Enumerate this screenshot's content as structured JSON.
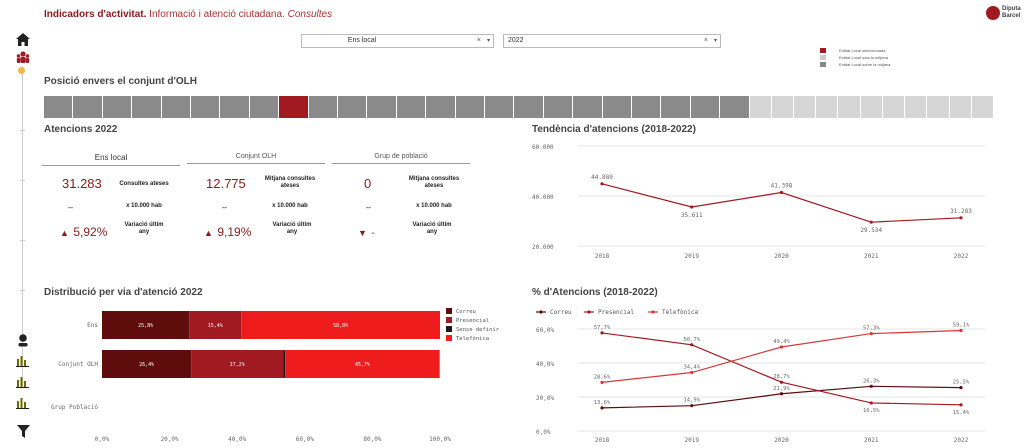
{
  "header": {
    "title_bold": "Indicadors d'activitat.",
    "title_normal": " Informació i atenció ciutadana.",
    "title_italic": " Consultes",
    "logo_line1": "Diputa",
    "logo_line2": "Barcel"
  },
  "filters": {
    "ens": "Ens local",
    "year": "2022",
    "clear": "×",
    "chevron": "▾"
  },
  "legend": {
    "items": [
      {
        "label": "Entitat Local seleccionada",
        "color": "#a11a22"
      },
      {
        "label": "Entitat Local sota la mitjana",
        "color": "#cccccc"
      },
      {
        "label": "Entitat Local sobre la mitjana",
        "color": "#888888"
      }
    ]
  },
  "position": {
    "title": "Posició envers el conjunt d'OLH",
    "dark_count": 24,
    "light_count": 11,
    "selected_index": 8,
    "colors": {
      "dark": "#8a8a8a",
      "light": "#d6d6d6",
      "selected": "#a11a22"
    }
  },
  "atencions": {
    "title": "Atencions 2022",
    "cols": [
      {
        "header": "Ens local",
        "value": "31.283",
        "value_label": "Consultes ateses",
        "dash": "–",
        "per_label": "x 10.000 hab",
        "var_arrow": "▲",
        "var_value": "5,92%",
        "var_label": "Variació últim any"
      },
      {
        "header": "Conjunt OLH",
        "value": "12.775",
        "value_label": "Mitjana consultes ateses",
        "dash": "–",
        "per_label": "x 10.000 hab",
        "var_arrow": "▲",
        "var_value": "9,19%",
        "var_label": "Variació últim any"
      },
      {
        "header": "Grup de població",
        "value": "0",
        "value_label": "Mitjana consultes ateses",
        "dash": "–",
        "per_label": "x 10.000 hab",
        "var_arrow": "▼",
        "var_value": "-",
        "var_label": "Variació últim any"
      }
    ]
  },
  "tendencia": {
    "title": "Tendència d'atencions (2018-2022)",
    "chart_data": {
      "type": "line",
      "x": [
        "2018",
        "2019",
        "2020",
        "2021",
        "2022"
      ],
      "series": [
        {
          "values": [
            44880,
            35611,
            41398,
            29534,
            31283
          ]
        }
      ],
      "point_labels": [
        "44.880",
        "35.611",
        "41.398",
        "29.534",
        "31.283"
      ],
      "ylim": [
        20000,
        60000
      ],
      "yticks": [
        20000,
        40000,
        60000
      ],
      "ytick_labels": [
        "20.000",
        "40.000",
        "60.000"
      ],
      "color": "#a11a22",
      "grid": true
    }
  },
  "distribucio": {
    "title": "Distribució per via d'atenció 2022",
    "chart_data": {
      "type": "bar",
      "orientation": "horizontal-stacked",
      "categories": [
        "Ens",
        "Conjunt OLH",
        "Grup Població"
      ],
      "series": [
        {
          "name": "Correu",
          "color": "#5e0c0c",
          "values": [
            25.8,
            26.4,
            0
          ],
          "labels": [
            "25,8%",
            "26,4%",
            ""
          ]
        },
        {
          "name": "Presencial",
          "color": "#a11a22",
          "values": [
            15.4,
            27.2,
            0
          ],
          "labels": [
            "15,4%",
            "27,2%",
            ""
          ]
        },
        {
          "name": "Sense definir",
          "color": "#1a1a1a",
          "values": [
            0,
            0.6,
            0
          ],
          "labels": [
            "",
            "",
            ""
          ]
        },
        {
          "name": "Telefònica",
          "color": "#ee1c1c",
          "values": [
            58.8,
            45.7,
            0
          ],
          "labels": [
            "58,8%",
            "45,7%",
            ""
          ]
        }
      ],
      "xlim": [
        0,
        100
      ],
      "xticks": [
        0,
        20,
        40,
        60,
        80,
        100
      ],
      "xtick_labels": [
        "0,0%",
        "20,0%",
        "40,0%",
        "60,0%",
        "80,0%",
        "100,0%"
      ]
    }
  },
  "percent": {
    "title": "% d'Atencions (2018-2022)",
    "chart_data": {
      "type": "line",
      "x": [
        "2018",
        "2019",
        "2020",
        "2021",
        "2022"
      ],
      "series": [
        {
          "name": "Correu",
          "color": "#5e0c0c",
          "values": [
            13.6,
            14.9,
            21.9,
            26.3,
            25.5
          ],
          "labels": [
            "13,6%",
            "14,9%",
            "21,9%",
            "26,3%",
            "25,5%"
          ]
        },
        {
          "name": "Presencial",
          "color": "#a11a22",
          "values": [
            57.7,
            50.7,
            28.7,
            16.5,
            15.4
          ],
          "labels": [
            "57,7%",
            "50,7%",
            "28,7%",
            "16,5%",
            "15,4%"
          ]
        },
        {
          "name": "Telefònica",
          "color": "#d33a3a",
          "values": [
            28.6,
            34.4,
            49.4,
            57.3,
            59.1
          ],
          "labels": [
            "28,6%",
            "34,4%",
            "49,4%",
            "57,3%",
            "59,1%"
          ]
        }
      ],
      "ylim": [
        0,
        60
      ],
      "yticks": [
        0,
        20,
        40,
        60
      ],
      "ytick_labels": [
        "0,0%",
        "20,0%",
        "40,0%",
        "60,0%"
      ],
      "grid": true
    }
  }
}
